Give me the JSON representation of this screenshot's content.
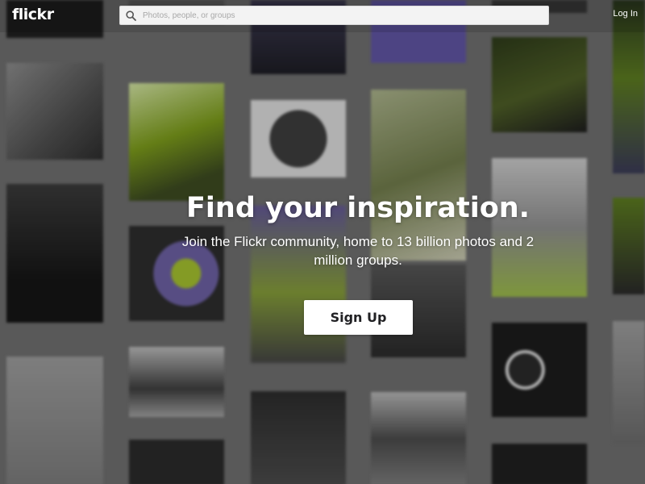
{
  "header": {
    "logo_text": "flickr",
    "search": {
      "placeholder": "Photos, people, or groups",
      "value": ""
    },
    "login_label": "Log In"
  },
  "hero": {
    "headline": "Find your inspiration.",
    "subtext": "Join the Flickr community, home to 13 billion photos and 2 million groups.",
    "cta_label": "Sign Up"
  },
  "theme": {
    "background_gray": "#6d6d6d",
    "accent_green": "#7b9a1c",
    "accent_purple": "#6b5fa0",
    "button_bg": "#ffffff",
    "text_white": "#ffffff"
  },
  "icons": {
    "search": "search-icon"
  }
}
